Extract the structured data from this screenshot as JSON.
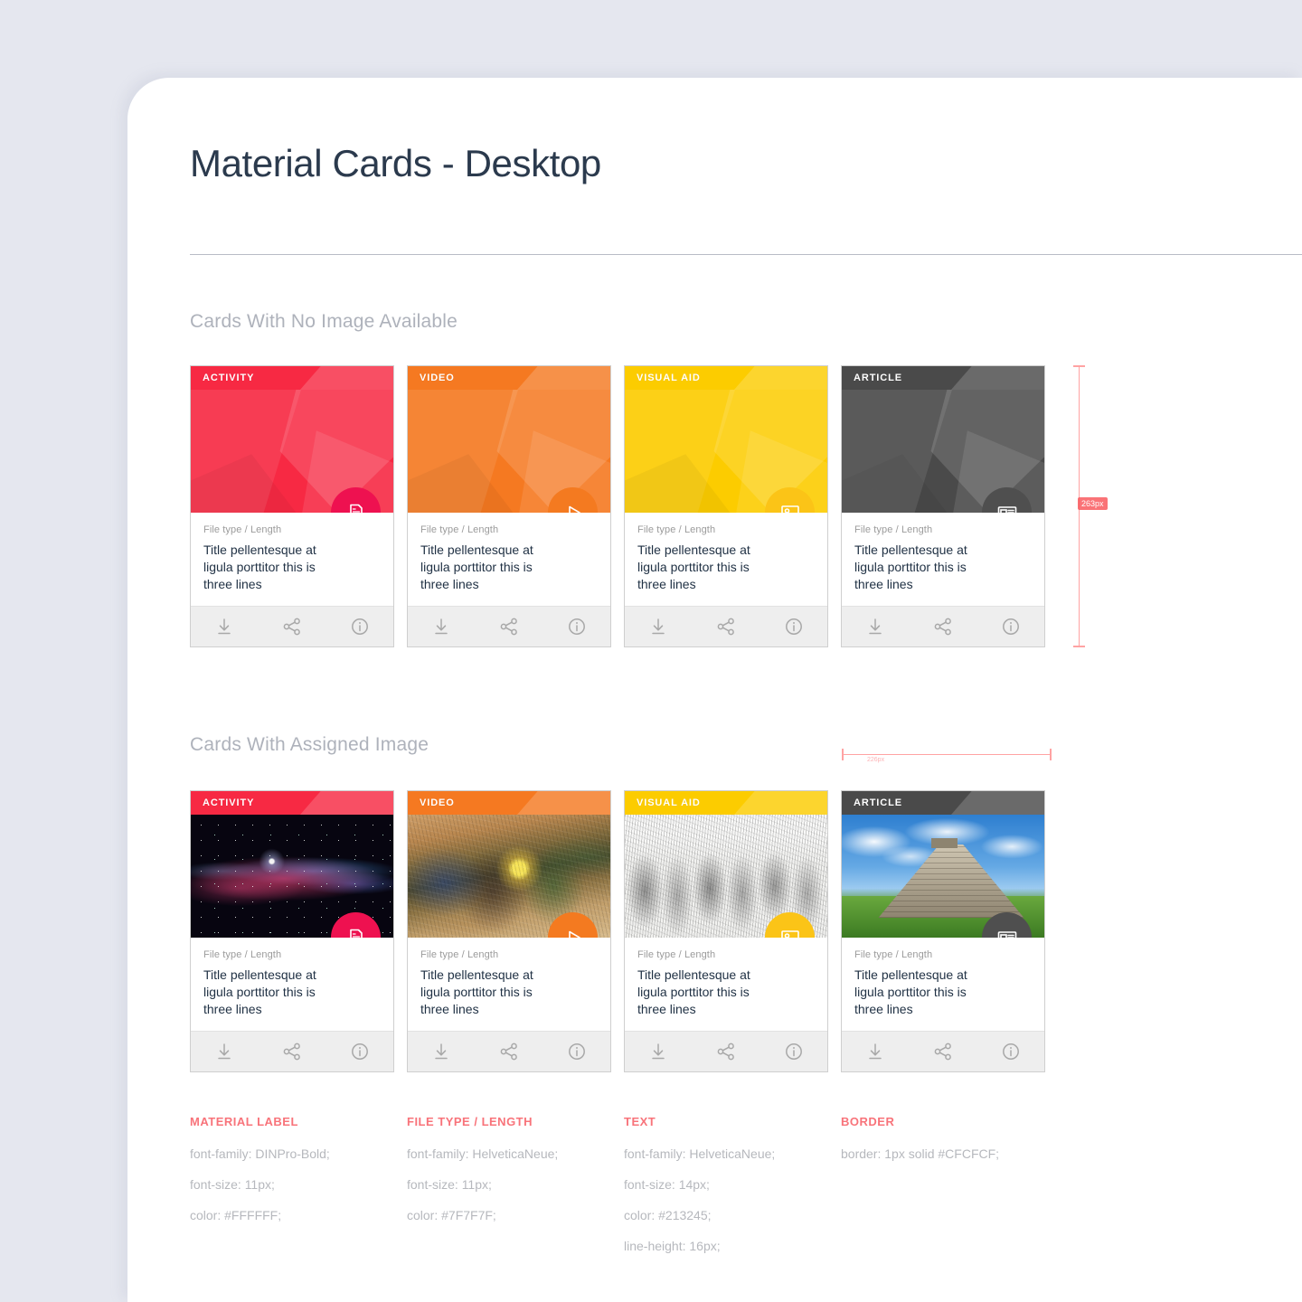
{
  "page": {
    "title": "Material Cards - Desktop",
    "background_color": "#E5E7EF",
    "sheet_color": "#FFFFFF"
  },
  "sections": [
    {
      "heading": "Cards With No Image Available"
    },
    {
      "heading": "Cards With Assigned Image"
    }
  ],
  "cards_no_image": [
    {
      "label": "ACTIVITY",
      "color": "#F72943",
      "fab_color": "#EE1150",
      "fab_icon": "document-icon",
      "filetype": "File type / Length",
      "title": "Title pellentesque at ligula porttitor this is three lines"
    },
    {
      "label": "VIDEO",
      "color": "#F57921",
      "fab_color": "#F47A20",
      "fab_icon": "play-icon",
      "filetype": "File type / Length",
      "title": "Title pellentesque at ligula porttitor this is three lines"
    },
    {
      "label": "VISUAL AID",
      "color": "#FCCC00",
      "fab_color": "#FBC417",
      "fab_icon": "image-icon",
      "filetype": "File type / Length",
      "title": "Title pellentesque at ligula porttitor this is three lines"
    },
    {
      "label": "ARTICLE",
      "color": "#4A4A4A",
      "fab_color": "#4F4F4F",
      "fab_icon": "article-icon",
      "filetype": "File type / Length",
      "title": "Title pellentesque at ligula porttitor this is three lines"
    }
  ],
  "cards_with_image": [
    {
      "label": "ACTIVITY",
      "color": "#F72943",
      "fab_color": "#EE1150",
      "fab_icon": "document-icon",
      "image": "nebula-space-photo",
      "filetype": "File type / Length",
      "title": "Title pellentesque at ligula porttitor this is three lines"
    },
    {
      "label": "VIDEO",
      "color": "#F57921",
      "fab_color": "#F47A20",
      "fab_icon": "play-icon",
      "image": "abstract-swirled-landscape",
      "filetype": "File type / Length",
      "title": "Title pellentesque at ligula porttitor this is three lines"
    },
    {
      "label": "VISUAL AID",
      "color": "#FCCC00",
      "fab_color": "#FBC417",
      "fab_icon": "image-icon",
      "image": "classical-engraving-crowd",
      "filetype": "File type / Length",
      "title": "Title pellentesque at ligula porttitor this is three lines"
    },
    {
      "label": "ARTICLE",
      "color": "#4A4A4A",
      "fab_color": "#4F4F4F",
      "fab_icon": "article-icon",
      "image": "mayan-pyramid-photo",
      "filetype": "File type / Length",
      "title": "Title pellentesque at ligula porttitor this is three lines"
    }
  ],
  "card_actions": [
    {
      "icon": "download-icon"
    },
    {
      "icon": "share-icon"
    },
    {
      "icon": "info-icon"
    }
  ],
  "measurements": {
    "height_label": "263px",
    "width_label": "226px"
  },
  "specs": [
    {
      "heading": "MATERIAL LABEL",
      "lines": [
        "font-family: DINPro-Bold;",
        "font-size: 11px;",
        "color: #FFFFFF;"
      ]
    },
    {
      "heading": "FILE TYPE / LENGTH",
      "lines": [
        "font-family: HelveticaNeue;",
        "font-size: 11px;",
        "color: #7F7F7F;"
      ]
    },
    {
      "heading": "TEXT",
      "lines": [
        "font-family: HelveticaNeue;",
        "font-size: 14px;",
        "color: #213245;",
        "line-height: 16px;"
      ]
    },
    {
      "heading": "BORDER",
      "lines": [
        "border: 1px solid #CFCFCF;"
      ]
    }
  ]
}
